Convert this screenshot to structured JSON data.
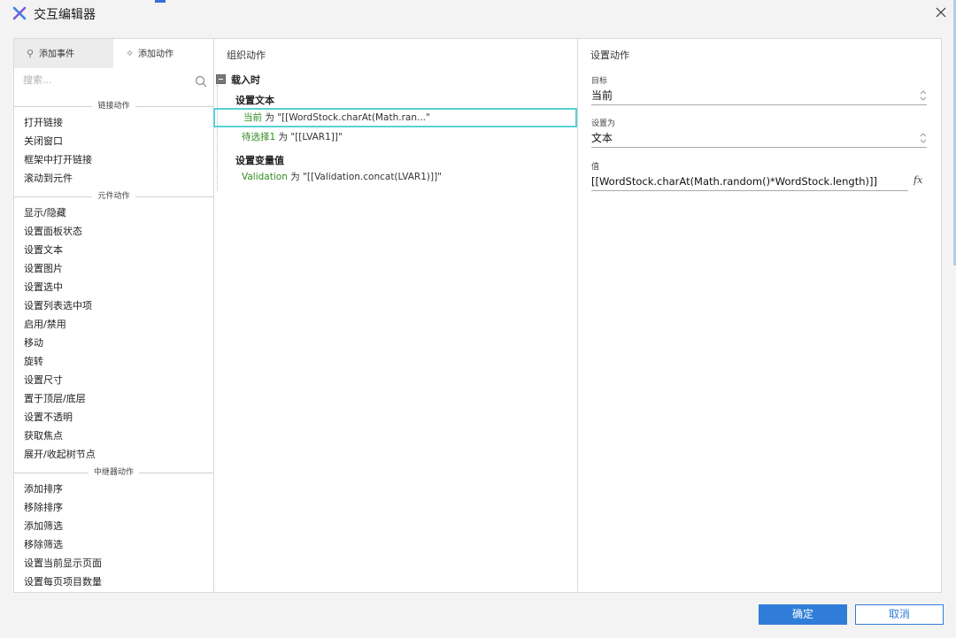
{
  "window": {
    "title": "交互编辑器"
  },
  "left_panel": {
    "tabs": [
      {
        "label": "添加事件",
        "icon": "event-icon"
      },
      {
        "label": "添加动作",
        "icon": "sparkle-icon"
      }
    ],
    "search_placeholder": "搜索...",
    "groups": [
      {
        "header": "链接动作",
        "items": [
          "打开链接",
          "关闭窗口",
          "框架中打开链接",
          "滚动到元件"
        ]
      },
      {
        "header": "元件动作",
        "items": [
          "显示/隐藏",
          "设置面板状态",
          "设置文本",
          "设置图片",
          "设置选中",
          "设置列表选中项",
          "启用/禁用",
          "移动",
          "旋转",
          "设置尺寸",
          "置于顶层/底层",
          "设置不透明",
          "获取焦点",
          "展开/收起树节点"
        ]
      },
      {
        "header": "中继器动作",
        "items": [
          "添加排序",
          "移除排序",
          "添加筛选",
          "移除筛选",
          "设置当前显示页面",
          "设置每页项目数量"
        ]
      }
    ]
  },
  "middle_panel": {
    "title": "组织动作",
    "event": "载入时",
    "actions": [
      {
        "title": "设置文本",
        "subs": [
          {
            "target": "当前",
            "word": "为",
            "value": "\"[[WordStock.charAt(Math.ran...\""
          },
          {
            "target": "待选择1",
            "word": "为",
            "value": "\"[[LVAR1]]\""
          }
        ]
      },
      {
        "title": "设置变量值",
        "subs": [
          {
            "target": "Validation",
            "word": "为",
            "value": "\"[[Validation.concat(LVAR1)]]\""
          }
        ]
      }
    ]
  },
  "right_panel": {
    "title": "设置动作",
    "target_label": "目标",
    "target_value": "当前",
    "set_as_label": "设置为",
    "set_as_value": "文本",
    "value_label": "值",
    "value": "[[WordStock.charAt(Math.random()*WordStock.length)]]"
  },
  "footer": {
    "ok_label": "确定",
    "cancel_label": "取消"
  },
  "colors": {
    "primary": "#2f7dd8",
    "selection": "#59d0d6",
    "target_green": "#2e8b1e"
  }
}
